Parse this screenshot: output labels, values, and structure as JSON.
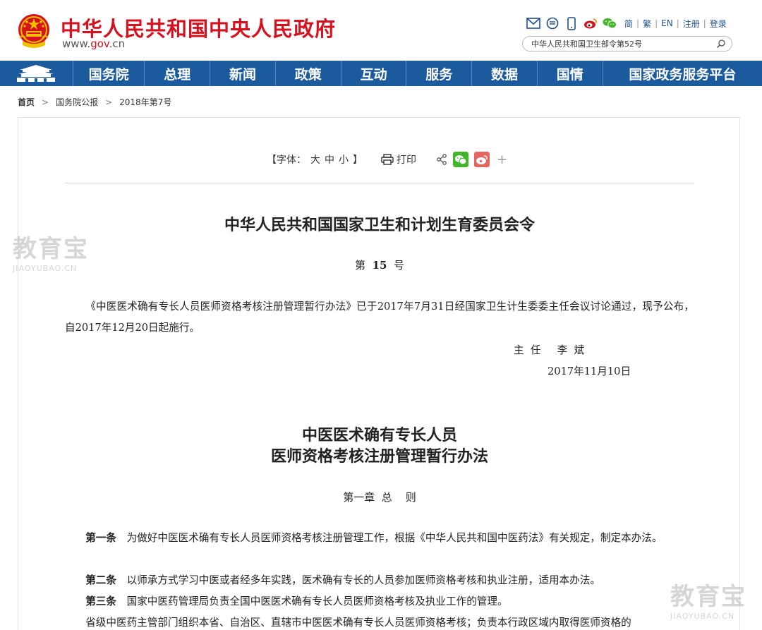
{
  "header": {
    "site_title": "中华人民共和国中央人民政府",
    "url_prefix": "www.",
    "url_gov": "gov",
    "url_suffix": ".cn",
    "lang_simplified": "简",
    "lang_traditional": "繁",
    "lang_english": "EN",
    "register": "注册",
    "login": "登录",
    "search_value": "中华人民共和国卫生部令第52号"
  },
  "nav": {
    "items": [
      "国务院",
      "总理",
      "新闻",
      "政策",
      "互动",
      "服务",
      "数据",
      "国情",
      "国家政务服务平台"
    ]
  },
  "breadcrumb": {
    "home": "首页",
    "level1": "国务院公报",
    "level2": "2018年第7号",
    "separator": ">"
  },
  "toolbar": {
    "font_open": "【字体：",
    "font_large": "大",
    "font_medium": "中",
    "font_small": "小",
    "font_close": "】",
    "print": "打印",
    "plus": "+"
  },
  "document": {
    "title": "中华人民共和国国家卫生和计划生育委员会令",
    "number_prefix": "第  ",
    "number": "15",
    "number_suffix": "  号",
    "intro": "《中医医术确有专长人员医师资格考核注册管理暂行办法》已于2017年7月31日经国家卫生计生委委主任会议讨论通过，现予公布，自2017年12月20日起施行。",
    "signer": "主  任     李  斌",
    "sign_date": "2017年11月10日",
    "law_title_line1": "中医医术确有专长人员",
    "law_title_line2": "医师资格考核注册管理暂行办法",
    "chapter": "第一章  总    则",
    "articles": [
      {
        "label": "第一条",
        "text": "为做好中医医术确有专长人员医师资格考核注册管理工作，根据《中华人民共和国中医药法》有关规定，制定本办法。"
      },
      {
        "label": "第二条",
        "text": "以师承方式学习中医或者经多年实践，医术确有专长的人员参加医师资格考核和执业注册，适用本办法。"
      },
      {
        "label": "第三条",
        "text": "国家中医药管理局负责全国中医医术确有专长人员医师资格考核及执业工作的管理。"
      }
    ],
    "partial_para": "省级中医药主管部门组织本省、自治区、直辖市中医医术确有专长人员医师资格考核；负责本行政区域内取得医师资格的"
  },
  "watermarks": {
    "cn": "教育宝",
    "en": "JIAOYUBAO.CN"
  },
  "colors": {
    "brand_red": "#d6121f",
    "nav_blue": "#1c5a9e",
    "wechat_green": "#43b52b",
    "weibo_red": "#e7655c"
  }
}
